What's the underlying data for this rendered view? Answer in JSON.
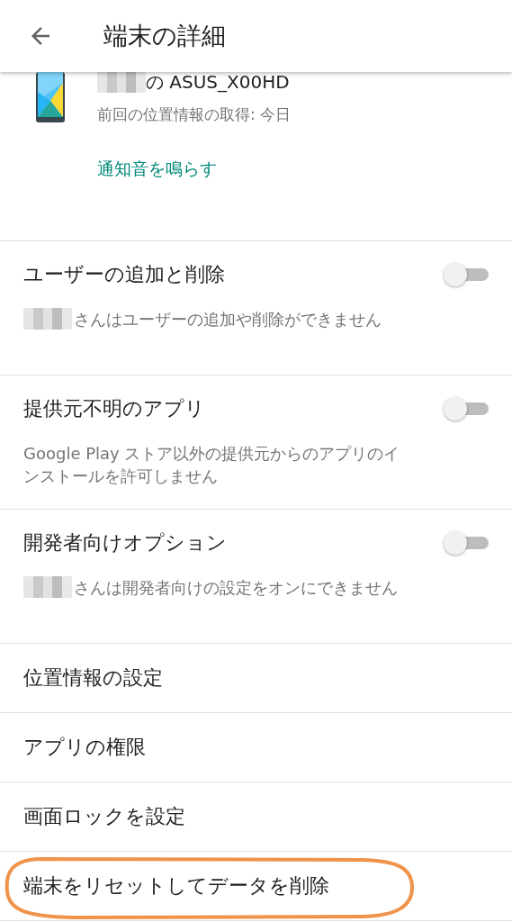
{
  "header": {
    "title": "端末の詳細"
  },
  "device": {
    "name_redacted": true,
    "name": "の ASUS_X00HD",
    "last_location": "前回の位置情報の取得: 今日",
    "action": "通知音を鳴らす"
  },
  "settings": [
    {
      "kind": "toggle",
      "title": "ユーザーの追加と削除",
      "description": "さんはユーザーの追加や削除ができません",
      "redacted": true,
      "on": false
    },
    {
      "kind": "toggle",
      "title": "提供元不明のアプリ",
      "description": "Google Play ストア以外の提供元からのアプリのインストールを許可しません",
      "redacted": false,
      "on": false
    },
    {
      "kind": "toggle",
      "title": "開発者向けオプション",
      "description": "さんは開発者向けの設定をオンにできません",
      "redacted": true,
      "on": false
    },
    {
      "kind": "link",
      "title": "位置情報の設定",
      "highlighted": false
    },
    {
      "kind": "link",
      "title": "アプリの権限",
      "highlighted": false
    },
    {
      "kind": "link",
      "title": "画面ロックを設定",
      "highlighted": false
    },
    {
      "kind": "link",
      "title": "端末をリセットしてデータを削除",
      "highlighted": true
    }
  ]
}
